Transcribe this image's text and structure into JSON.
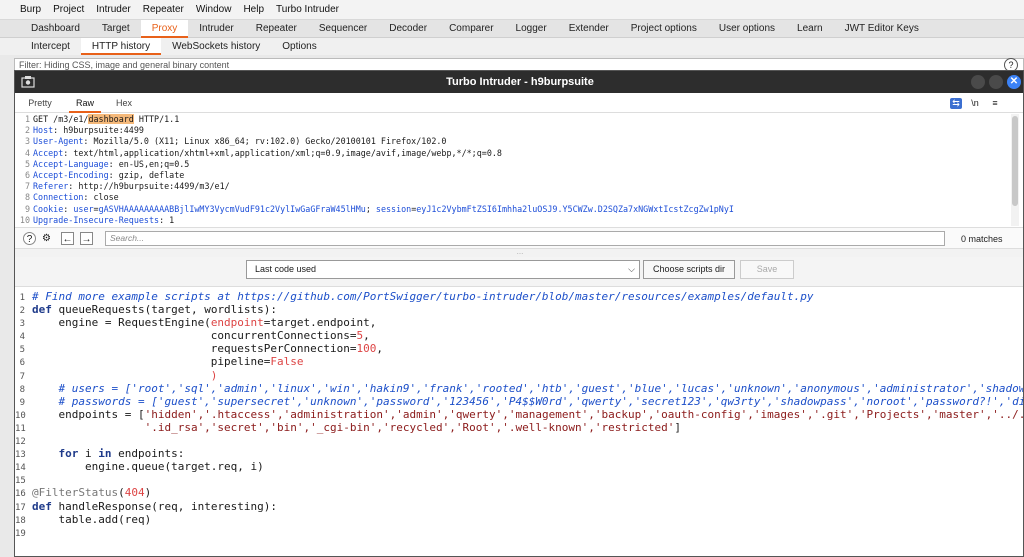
{
  "burp": {
    "menu": [
      "Burp",
      "Project",
      "Intruder",
      "Repeater",
      "Window",
      "Help",
      "Turbo Intruder"
    ],
    "main_tabs": [
      "Dashboard",
      "Target",
      "Proxy",
      "Intruder",
      "Repeater",
      "Sequencer",
      "Decoder",
      "Comparer",
      "Logger",
      "Extender",
      "Project options",
      "User options",
      "Learn",
      "JWT Editor Keys"
    ],
    "active_main_tab": "Proxy",
    "sub_tabs": [
      "Intercept",
      "HTTP history",
      "WebSockets history",
      "Options"
    ],
    "active_sub_tab": "HTTP history",
    "filter_text": "Filter: Hiding CSS, image and general binary content",
    "help_label": "?"
  },
  "window": {
    "title": "Turbo Intruder - h9burpsuite",
    "close_label": "✕"
  },
  "request_tabs": {
    "pretty": "Pretty",
    "raw": "Raw",
    "hex": "Hex",
    "newline_icon_label": "\\n",
    "menu_icon_label": "≡",
    "wrap_icon_label": "⇆"
  },
  "request": {
    "line1_a": "GET /m3/e1/",
    "line1_hl": "dashboard",
    "line1_b": " HTTP/1.1",
    "headers": [
      {
        "n": "2",
        "k": "Host",
        "v": " h9burpsuite:4499"
      },
      {
        "n": "3",
        "k": "User-Agent",
        "v": " Mozilla/5.0 (X11; Linux x86_64; rv:102.0) Gecko/20100101 Firefox/102.0"
      },
      {
        "n": "4",
        "k": "Accept",
        "v": " text/html,application/xhtml+xml,application/xml;q=0.9,image/avif,image/webp,*/*;q=0.8"
      },
      {
        "n": "5",
        "k": "Accept-Language",
        "v": " en-US,en;q=0.5"
      },
      {
        "n": "6",
        "k": "Accept-Encoding",
        "v": " gzip, deflate"
      },
      {
        "n": "7",
        "k": "Referer",
        "v": " http://h9burpsuite:4499/m3/e1/"
      },
      {
        "n": "8",
        "k": "Connection",
        "v": " close"
      }
    ],
    "cookie_key": "Cookie",
    "cookie_user_name": "user",
    "cookie_user_val": "gASVHAAAAAAAAABBjlIwMY3VycmVudF91c2VylIwGaGFraW45lHMu",
    "cookie_session_name": "session",
    "cookie_session_val": "eyJ1c2VybmFtZSI6Imhha2luOSJ9.Y5CWZw.D2SQZa7xNGWxtIcstZcgZw1pNyI",
    "line10_k": "Upgrade-Insecure-Requests",
    "line10_v": " 1"
  },
  "search": {
    "placeholder": "Search...",
    "matches": "0 matches",
    "help_icon": "?",
    "settings_icon": "⚙",
    "prev_icon": "←",
    "next_icon": "→"
  },
  "splitter_label": "...",
  "controls": {
    "selected_script": "Last code used",
    "choose_dir_label": "Choose scripts dir",
    "save_label": "Save"
  },
  "code": {
    "l1": "# Find more example scripts at https://github.com/PortSwigger/turbo-intruder/blob/master/resources/examples/default.py",
    "l2_kw": "def",
    "l2_rest": " queueRequests(target, wordlists):",
    "l3_a": "    engine = RequestEngine(",
    "l3_b": "endpoint",
    "l3_c": "=target.endpoint,",
    "l4_a": "                           concurrentConnections",
    "l4_num": "5",
    "l5_a": "                           requestsPerConnection",
    "l5_num": "100",
    "l6_a": "                           pipeline",
    "l6_val": "False",
    "l7": "                           )",
    "l8": "    # users = ['root','sql','admin','linux','win','hakin9','frank','rooted','htb','guest','blue','lucas','unknown','anonymous','administrator','shadow','_p",
    "l9": "    # passwords = ['guest','supersecret','unknown','password','123456','P4$$W0rd','qwerty','secret123','qw3rty','shadowpass','noroot','password?!','diffpas",
    "l10_a": "    endpoints = [",
    "l10_str": "'hidden','.htaccess','administration','admin','qwerty','management','backup','oauth-config','images','.git','Projects','master','../../../",
    "l11_str": "                 '.id_rsa','secret','bin','_cgi-bin','recycled','Root','.well-known','restricted'",
    "l11_end": "]",
    "l13_kw1": "for",
    "l13_mid": " i ",
    "l13_kw2": "in",
    "l13_rest": " endpoints:",
    "l14": "        engine.queue(target.req, i)",
    "l16_dec": "@FilterStatus",
    "l16_num": "404",
    "l17_kw": "def",
    "l17_rest": " handleResponse(req, interesting):",
    "l18": "    table.add(req)"
  }
}
